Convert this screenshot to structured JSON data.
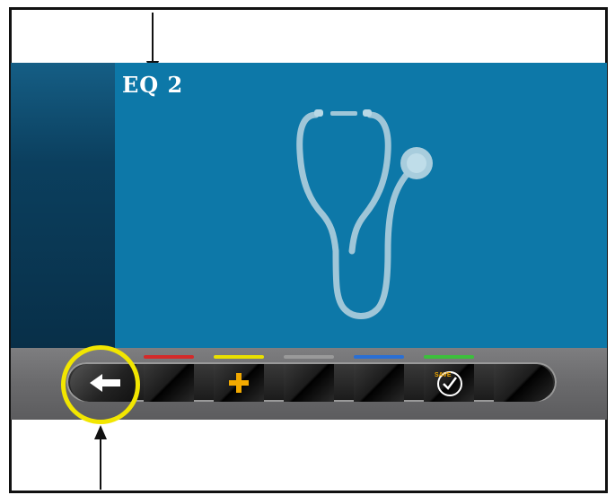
{
  "screen": {
    "title": "EQ 2",
    "background_color": "#0d78a8",
    "sidebar_color": "#0b3f5e",
    "illustration": "stethoscope-icon"
  },
  "toolbar": {
    "buttons": [
      {
        "name": "back-button",
        "icon": "left-arrow-icon",
        "indicator": null
      },
      {
        "name": "red-softkey",
        "icon": null,
        "indicator": "#d42a2a"
      },
      {
        "name": "yellow-add-softkey",
        "icon": "plus-icon",
        "indicator": "#e9e100"
      },
      {
        "name": "gray-softkey",
        "icon": null,
        "indicator": "#9a9a9a"
      },
      {
        "name": "blue-softkey",
        "icon": null,
        "indicator": "#2a6fd4"
      },
      {
        "name": "green-save-softkey",
        "icon": "save-check-icon",
        "label": "SAVE",
        "indicator": "#3cbf3c"
      },
      {
        "name": "end-softkey",
        "icon": null,
        "indicator": null
      }
    ]
  },
  "annotations": {
    "highlight_color": "#f2e600",
    "callouts": [
      "title-arrow",
      "back-button-arrow"
    ]
  }
}
